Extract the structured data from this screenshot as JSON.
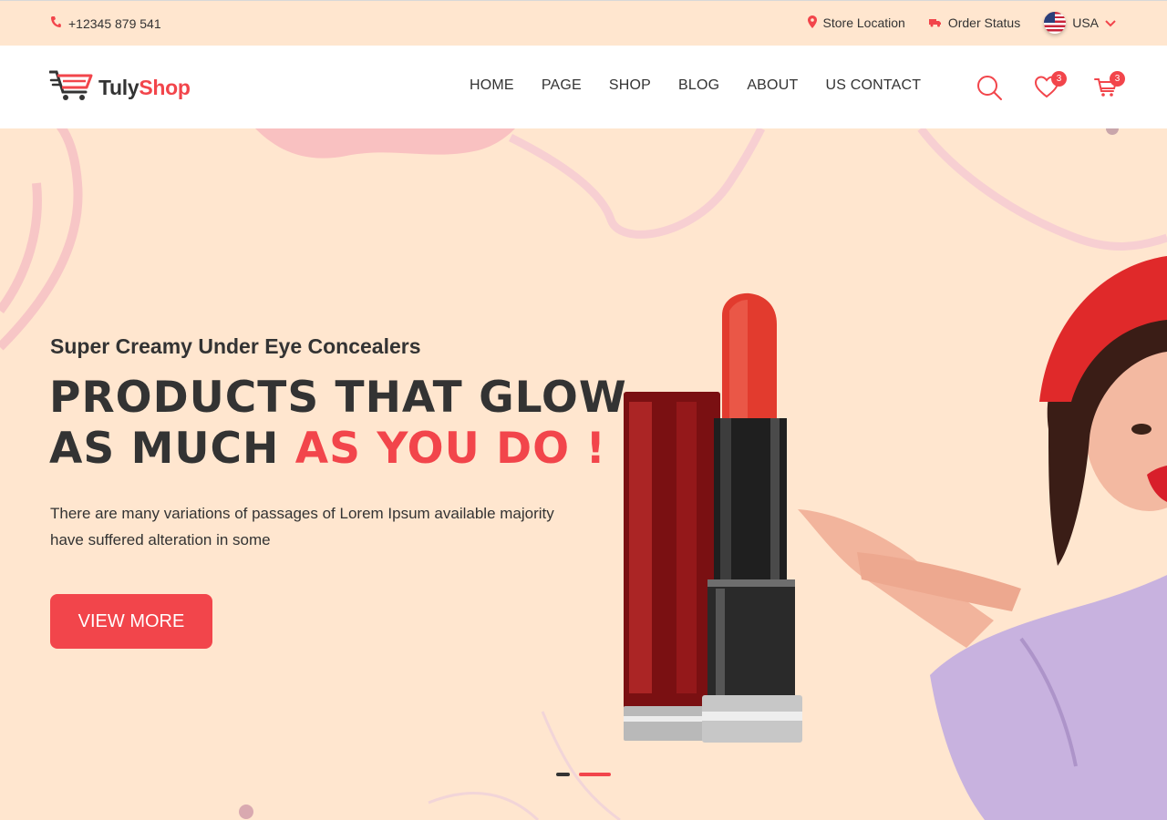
{
  "topbar": {
    "phone": "+12345 879 541",
    "store_location": "Store Location",
    "order_status": "Order Status",
    "country": "USA"
  },
  "header": {
    "logo": {
      "part1": "Tuly",
      "part2": "Shop"
    },
    "nav": [
      "HOME",
      "PAGE",
      "SHOP",
      "BLOG",
      "ABOUT",
      "US CONTACT"
    ],
    "wishlist_count": "3",
    "cart_count": "3"
  },
  "hero": {
    "subtitle": "Super Creamy Under Eye Concealers",
    "headline_line1": "PRODUCTS THAT GLOW",
    "headline_line2_plain": "AS MUCH",
    "headline_line2_accent": "AS YOU DO !",
    "description": "There are many variations of passages of Lorem Ipsum available majority have suffered alteration in some",
    "cta_label": "VIEW MORE",
    "slides_active_index": 1
  },
  "colors": {
    "accent": "#f2454b",
    "topbar_bg": "#ffe6cf",
    "hero_bg": "#ffe6cf",
    "text": "#333333"
  },
  "icons": [
    "phone-icon",
    "location-pin-icon",
    "truck-icon",
    "usa-flag-icon",
    "chevron-down-icon",
    "cart-logo-icon",
    "search-icon",
    "heart-icon",
    "cart-icon"
  ]
}
